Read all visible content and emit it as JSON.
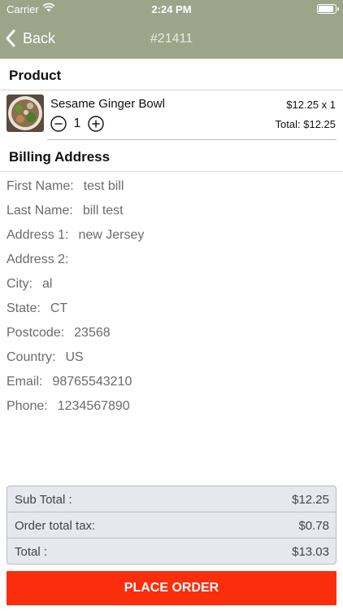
{
  "status_bar": {
    "carrier": "Carrier",
    "time": "2:24 PM",
    "battery_level": 0.95
  },
  "nav": {
    "back_label": "Back",
    "title": "#21411",
    "background_color": "#9ca48a"
  },
  "product_section": {
    "title": "Product",
    "item": {
      "name": "Sesame Ginger Bowl",
      "quantity": "1",
      "price_line": "$12.25 x 1",
      "total_line": "Total: $12.25"
    }
  },
  "billing_section": {
    "title": "Billing Address",
    "fields": [
      {
        "label": "First Name:",
        "value": "test bill"
      },
      {
        "label": "Last Name:",
        "value": "bill test"
      },
      {
        "label": "Address 1:",
        "value": "new Jersey"
      },
      {
        "label": "Address 2:",
        "value": ""
      },
      {
        "label": "City:",
        "value": "al"
      },
      {
        "label": "State:",
        "value": "CT"
      },
      {
        "label": "Postcode:",
        "value": "23568"
      },
      {
        "label": "Country:",
        "value": "US"
      },
      {
        "label": "Email:",
        "value": "98765543210"
      },
      {
        "label": "Phone:",
        "value": "1234567890"
      }
    ]
  },
  "summary": {
    "rows": [
      {
        "label": "Sub Total :",
        "value": "$12.25"
      },
      {
        "label": "Order total tax:",
        "value": "$0.78"
      },
      {
        "label": "Total :",
        "value": "$13.03"
      }
    ]
  },
  "place_order_label": "PLACE ORDER",
  "colors": {
    "accent": "#fa2e0c",
    "summary_bg": "#e6e8ee"
  }
}
